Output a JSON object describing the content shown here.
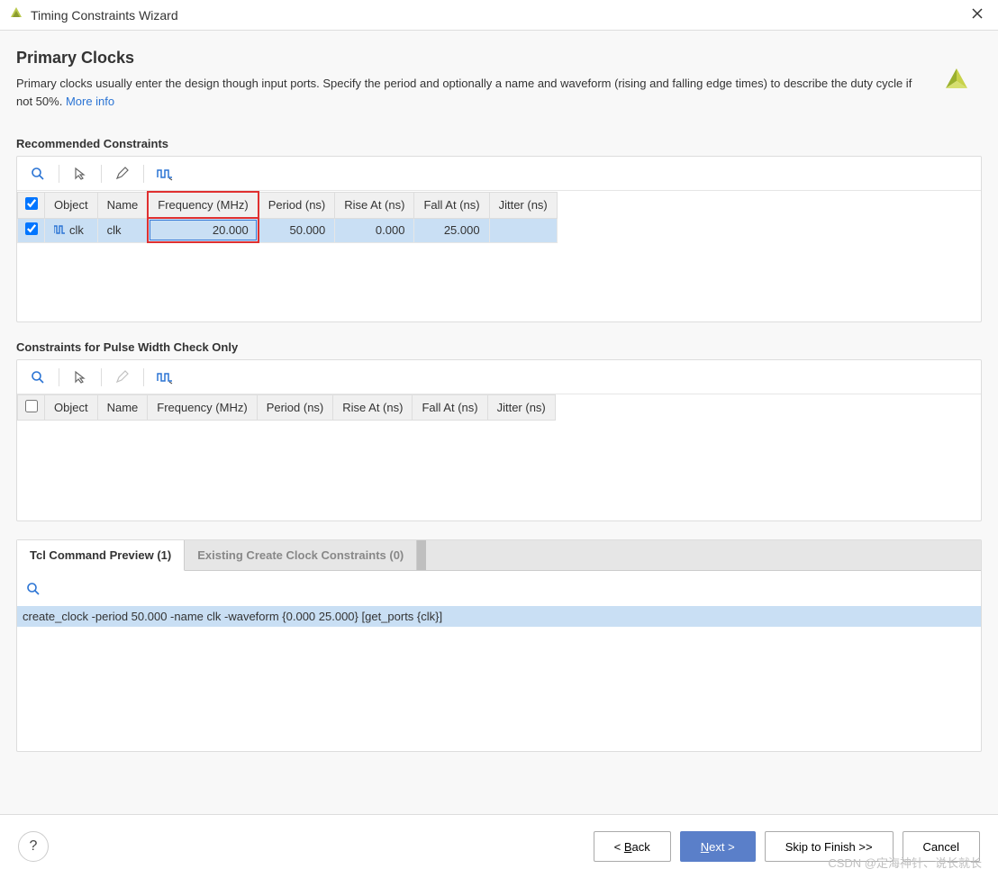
{
  "window": {
    "title": "Timing Constraints Wizard"
  },
  "page": {
    "title": "Primary Clocks",
    "desc": "Primary clocks usually enter the design though input ports. Specify the period and optionally a name and waveform (rising and falling edge times) to describe the duty cycle if not 50%. ",
    "more": "More info"
  },
  "section1": {
    "title": "Recommended Constraints",
    "columns": {
      "c0": "",
      "c1": "Object",
      "c2": "Name",
      "c3": "Frequency (MHz)",
      "c4": "Period (ns)",
      "c5": "Rise At (ns)",
      "c6": "Fall At (ns)",
      "c7": "Jitter (ns)"
    },
    "row1": {
      "object": "clk",
      "name": "clk",
      "freq": "20.000",
      "period": "50.000",
      "rise": "0.000",
      "fall": "25.000",
      "jitter": ""
    }
  },
  "section2": {
    "title": "Constraints for Pulse Width Check Only",
    "columns": {
      "c0": "",
      "c1": "Object",
      "c2": "Name",
      "c3": "Frequency (MHz)",
      "c4": "Period (ns)",
      "c5": "Rise At (ns)",
      "c6": "Fall At (ns)",
      "c7": "Jitter (ns)"
    }
  },
  "tabs": {
    "t1": "Tcl Command Preview (1)",
    "t2": "Existing Create Clock Constraints (0)"
  },
  "tcl": {
    "line": "create_clock -period 50.000 -name clk -waveform {0.000 25.000} [get_ports {clk}]"
  },
  "footer": {
    "back": "< Back",
    "back_u": "B",
    "next": "Next >",
    "next_u": "N",
    "skip": "Skip to Finish >>",
    "cancel": "Cancel"
  },
  "watermark": "CSDN @定海神针、说长就长"
}
